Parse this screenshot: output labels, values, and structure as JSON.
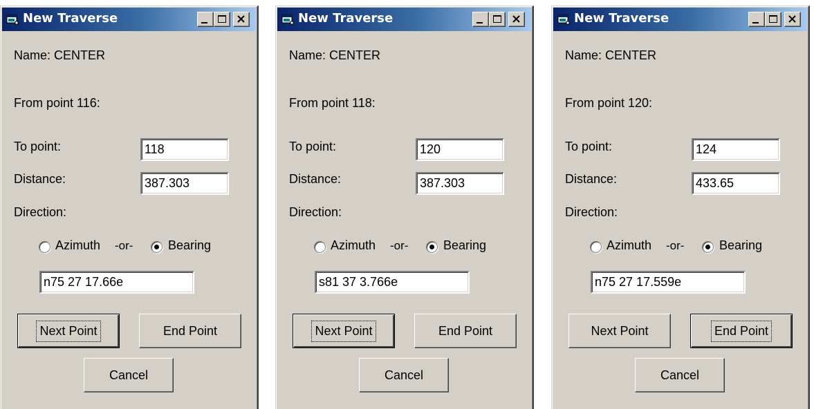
{
  "dialogs": [
    {
      "title": "New Traverse",
      "name_text": "Name: CENTER",
      "from_text": "From point 116:",
      "to_label": "To point:",
      "to_value": "118",
      "distance_label": "Distance:",
      "distance_value": "387.303",
      "direction_label": "Direction:",
      "azimuth_label": "Azimuth",
      "or_label": "-or-",
      "bearing_label": "Bearing",
      "selected_direction": "bearing",
      "direction_value": "n75 27 17.66e",
      "next_label": "Next Point",
      "end_label": "End Point",
      "cancel_label": "Cancel",
      "default_button": "next"
    },
    {
      "title": "New Traverse",
      "name_text": "Name: CENTER",
      "from_text": "From point 118:",
      "to_label": "To point:",
      "to_value": "120",
      "distance_label": "Distance:",
      "distance_value": "387.303",
      "direction_label": "Direction:",
      "azimuth_label": "Azimuth",
      "or_label": "-or-",
      "bearing_label": "Bearing",
      "selected_direction": "bearing",
      "direction_value": "s81 37 3.766e",
      "next_label": "Next Point",
      "end_label": "End Point",
      "cancel_label": "Cancel",
      "default_button": "next"
    },
    {
      "title": "New Traverse",
      "name_text": "Name: CENTER",
      "from_text": "From point 120:",
      "to_label": "To point:",
      "to_value": "124",
      "distance_label": "Distance:",
      "distance_value": "433.65",
      "direction_label": "Direction:",
      "azimuth_label": "Azimuth",
      "or_label": "-or-",
      "bearing_label": "Bearing",
      "selected_direction": "bearing",
      "direction_value": "n75 27 17.559e",
      "next_label": "Next Point",
      "end_label": "End Point",
      "cancel_label": "Cancel",
      "default_button": "end"
    }
  ],
  "colors": {
    "title_start": "#0a246a",
    "title_end": "#a6caf0",
    "face": "#d4d0c8"
  },
  "icons": {
    "app": "window-app-icon",
    "minimize": "minimize-icon",
    "maximize": "maximize-icon",
    "close": "close-icon"
  }
}
